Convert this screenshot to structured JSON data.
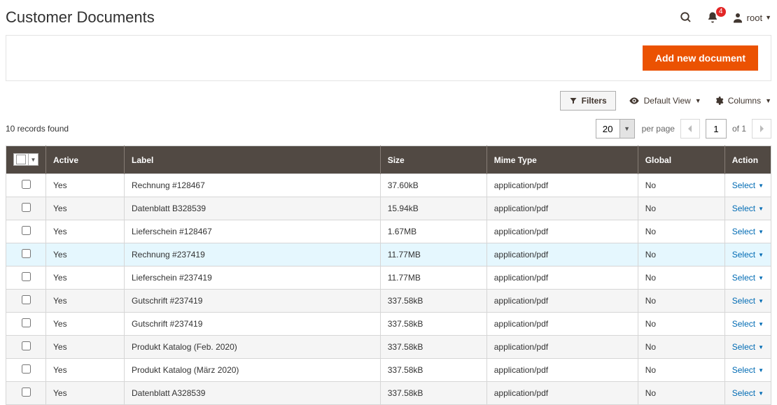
{
  "header": {
    "title": "Customer Documents",
    "notification_count": "4",
    "user_name": "root"
  },
  "action_bar": {
    "add_button": "Add new document"
  },
  "toolbar": {
    "filters": "Filters",
    "default_view": "Default View",
    "columns": "Columns"
  },
  "listing": {
    "records_found": "10 records found",
    "per_page_value": "20",
    "per_page_label": "per page",
    "page_value": "1",
    "of_label": "of 1"
  },
  "columns": {
    "active": "Active",
    "label": "Label",
    "size": "Size",
    "mime": "Mime Type",
    "global": "Global",
    "action": "Action"
  },
  "action_label": "Select",
  "rows": [
    {
      "active": "Yes",
      "label": "Rechnung #128467",
      "size": "37.60kB",
      "mime": "application/pdf",
      "global": "No",
      "highlight": false
    },
    {
      "active": "Yes",
      "label": "Datenblatt B328539",
      "size": "15.94kB",
      "mime": "application/pdf",
      "global": "No",
      "highlight": false
    },
    {
      "active": "Yes",
      "label": "Lieferschein #128467",
      "size": "1.67MB",
      "mime": "application/pdf",
      "global": "No",
      "highlight": false
    },
    {
      "active": "Yes",
      "label": "Rechnung #237419",
      "size": "11.77MB",
      "mime": "application/pdf",
      "global": "No",
      "highlight": true
    },
    {
      "active": "Yes",
      "label": "Lieferschein #237419",
      "size": "11.77MB",
      "mime": "application/pdf",
      "global": "No",
      "highlight": false
    },
    {
      "active": "Yes",
      "label": "Gutschrift #237419",
      "size": "337.58kB",
      "mime": "application/pdf",
      "global": "No",
      "highlight": false
    },
    {
      "active": "Yes",
      "label": "Gutschrift #237419",
      "size": "337.58kB",
      "mime": "application/pdf",
      "global": "No",
      "highlight": false
    },
    {
      "active": "Yes",
      "label": "Produkt Katalog (Feb. 2020)",
      "size": "337.58kB",
      "mime": "application/pdf",
      "global": "No",
      "highlight": false
    },
    {
      "active": "Yes",
      "label": "Produkt Katalog (März 2020)",
      "size": "337.58kB",
      "mime": "application/pdf",
      "global": "No",
      "highlight": false
    },
    {
      "active": "Yes",
      "label": "Datenblatt A328539",
      "size": "337.58kB",
      "mime": "application/pdf",
      "global": "No",
      "highlight": false
    }
  ]
}
